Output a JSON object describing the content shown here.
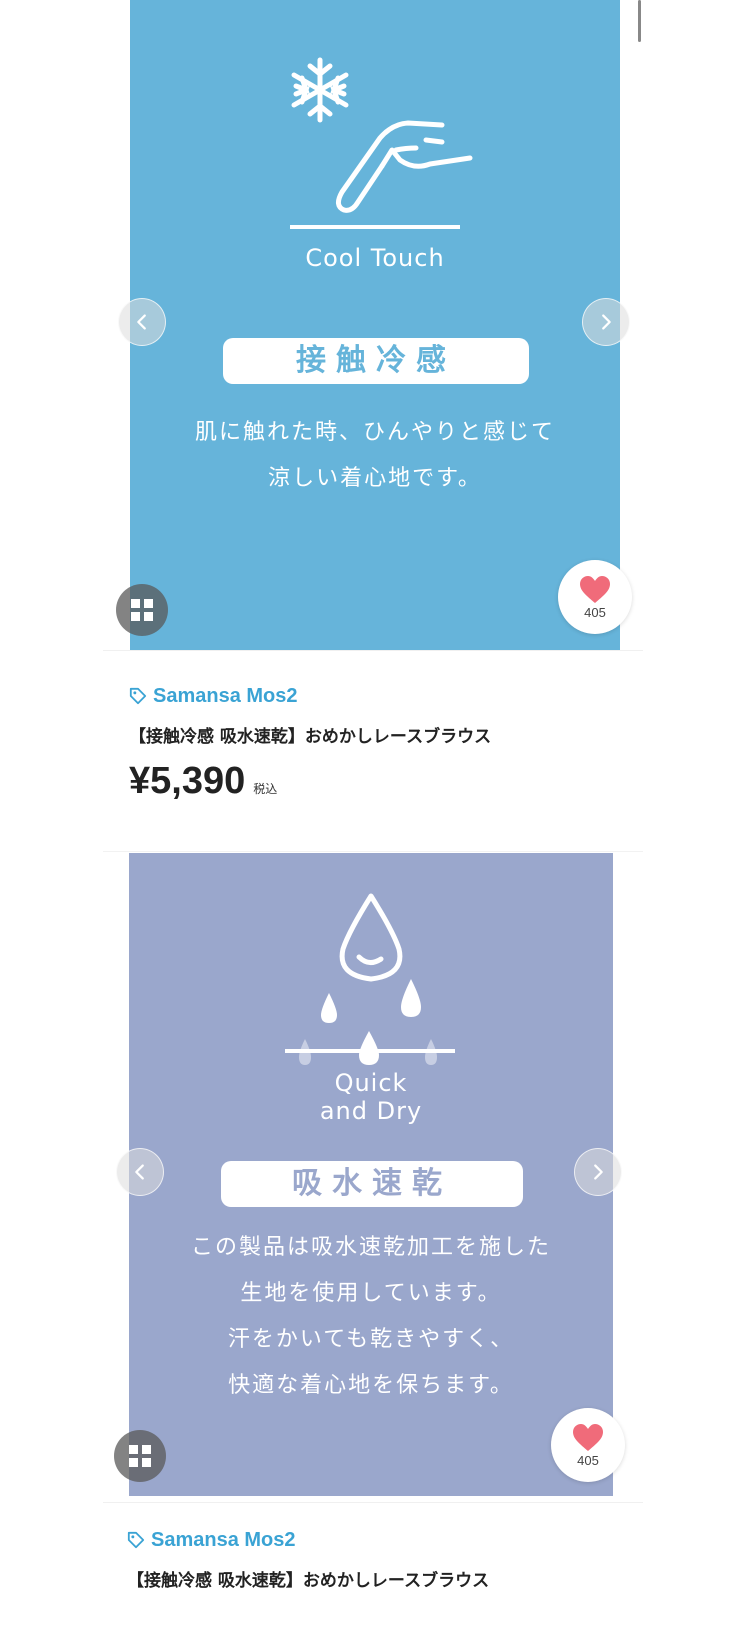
{
  "products": [
    {
      "image": {
        "caption_en": "Cool Touch",
        "label_jp": "接触冷感",
        "description": [
          "肌に触れた時、ひんやりと感じて",
          "涼しい着心地です。"
        ],
        "bg_color": "#66b4da",
        "icons": [
          "snowflake-icon",
          "hand-icon"
        ]
      },
      "favorite_count": "405",
      "brand": "Samansa Mos2",
      "title": "【接触冷感 吸水速乾】おめかしレースブラウス",
      "price": "¥5,390",
      "tax_label": "税込"
    },
    {
      "image": {
        "caption_en_line1": "Quick",
        "caption_en_line2": "and Dry",
        "label_jp": "吸水速乾",
        "description": [
          "この製品は吸水速乾加工を施した",
          "生地を使用しています。",
          "汗をかいても乾きやすく、",
          "快適な着心地を保ちます。"
        ],
        "bg_color": "#9aa7cc",
        "icons": [
          "water-drop-icon"
        ]
      },
      "favorite_count": "405",
      "brand": "Samansa Mos2",
      "title": "【接触冷感 吸水速乾】おめかしレースブラウス"
    }
  ],
  "colors": {
    "brand": "#3aa3d4",
    "heart": "#f06b7a"
  }
}
